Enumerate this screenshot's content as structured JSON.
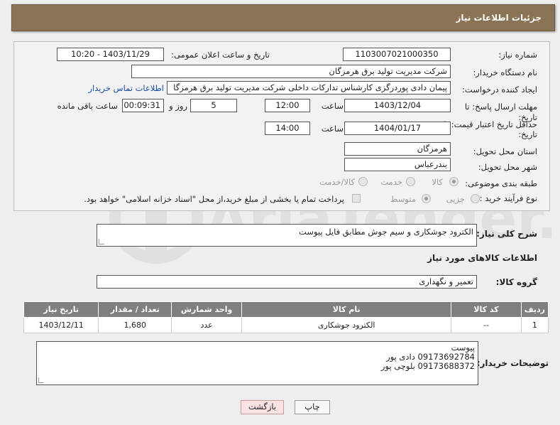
{
  "header": {
    "title": "جزئیات اطلاعات نیاز"
  },
  "form": {
    "need_number_label": "شماره نیاز:",
    "need_number": "1103007021000350",
    "announce_label": "تاریخ و ساعت اعلان عمومی:",
    "announce_value": "1403/11/29 - 10:20",
    "buyer_org_label": "نام دستگاه خریدار:",
    "buyer_org": "شرکت مدیریت تولید برق هرمزگان",
    "creator_label": "ایجاد کننده درخواست:",
    "creator": "پیمان دادی پوردرگزی کارشناس تدارکات داخلی شرکت مدیریت تولید برق هرمزگا",
    "contact_link": "اطلاعات تماس خریدار",
    "deadline_label_1": "مهلت ارسال پاسخ: تا",
    "deadline_label_2": "تاریخ:",
    "deadline_date": "1403/12/04",
    "time_word": "ساعت",
    "deadline_time": "12:00",
    "days": "5",
    "days_word": "روز و",
    "remaining": "00:09:31",
    "remaining_word": "ساعت باقی مانده",
    "price_valid_label_1": "حداقل تاریخ اعتبار قیمت: تا",
    "price_valid_label_2": "تاریخ:",
    "price_valid_date": "1404/01/17",
    "price_valid_time": "14:00",
    "province_label": "استان محل تحویل:",
    "province": "هرمزگان",
    "city_label": "شهر محل تحویل:",
    "city": "بندرعباس",
    "category_label": "طبقه بندی موضوعی:",
    "category_options": [
      "کالا",
      "خدمت",
      "کالا/خدمت"
    ],
    "purchase_type_label": "نوع فرآیند خرید :",
    "purchase_options": [
      "جزیی",
      "متوسط"
    ],
    "payment_note": "پرداخت تمام یا بخشی از مبلغ خرید،از محل \"اسناد خزانه اسلامی\" خواهد بود."
  },
  "description": {
    "label": "شرح کلی نیاز:",
    "value": "الکترود جوشکاری و سیم جوش مطابق فایل پیوست"
  },
  "goods": {
    "section_title": "اطلاعات کالاهای مورد نیاز",
    "group_label": "گروه کالا:",
    "group_value": "تعمیر و نگهداری",
    "columns": [
      "ردیف",
      "کد کالا",
      "نام کالا",
      "واحد شمارش",
      "تعداد / مقدار",
      "تاریخ نیاز"
    ],
    "rows": [
      [
        "1",
        "--",
        "الکترود جوشکاری",
        "عدد",
        "1,680",
        "1403/12/11"
      ]
    ]
  },
  "buyer_notes": {
    "label": "توضیحات خریدار:",
    "lines": [
      "پیوست",
      "09173692784 دادی پور",
      "09173688372 بلوچی پور"
    ]
  },
  "buttons": {
    "print": "چاپ",
    "back": "بازگشت"
  },
  "watermark": {
    "text": "AriaTender.neT"
  }
}
